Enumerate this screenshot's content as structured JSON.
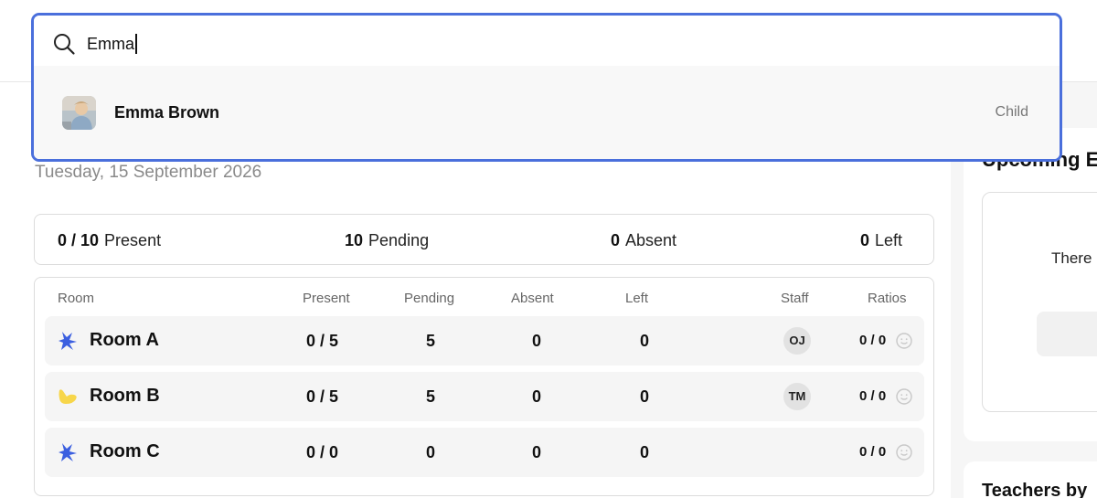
{
  "date": "Tuesday, 15 September 2026",
  "summary": {
    "present_value": "0 / 10",
    "present_label": "Present",
    "pending_value": "10",
    "pending_label": "Pending",
    "absent_value": "0",
    "absent_label": "Absent",
    "left_value": "0",
    "left_label": "Left"
  },
  "table": {
    "headers": [
      "Room",
      "Present",
      "Pending",
      "Absent",
      "Left",
      "Staff",
      "Ratios"
    ],
    "rows": [
      {
        "room": "Room A",
        "icon": "blue-splash-icon",
        "present": "0 / 5",
        "pending": "5",
        "absent": "0",
        "left": "0",
        "staff": "OJ",
        "ratio": "0 / 0"
      },
      {
        "room": "Room B",
        "icon": "yellow-blob-icon",
        "present": "0 / 5",
        "pending": "5",
        "absent": "0",
        "left": "0",
        "staff": "TM",
        "ratio": "0 / 0"
      },
      {
        "room": "Room C",
        "icon": "blue-splash-icon",
        "present": "0 / 0",
        "pending": "0",
        "absent": "0",
        "left": "0",
        "staff": "",
        "ratio": "0 / 0"
      }
    ]
  },
  "side": {
    "title1": "Upcoming E",
    "there_text": "There",
    "title2": "Teachers by"
  },
  "search": {
    "value": "Emma",
    "results": [
      {
        "name": "Emma Brown",
        "type": "Child"
      }
    ]
  },
  "colors": {
    "accent": "#4a6fdc",
    "room_blue": "#3b5fe0",
    "room_yellow": "#f7d64a"
  }
}
